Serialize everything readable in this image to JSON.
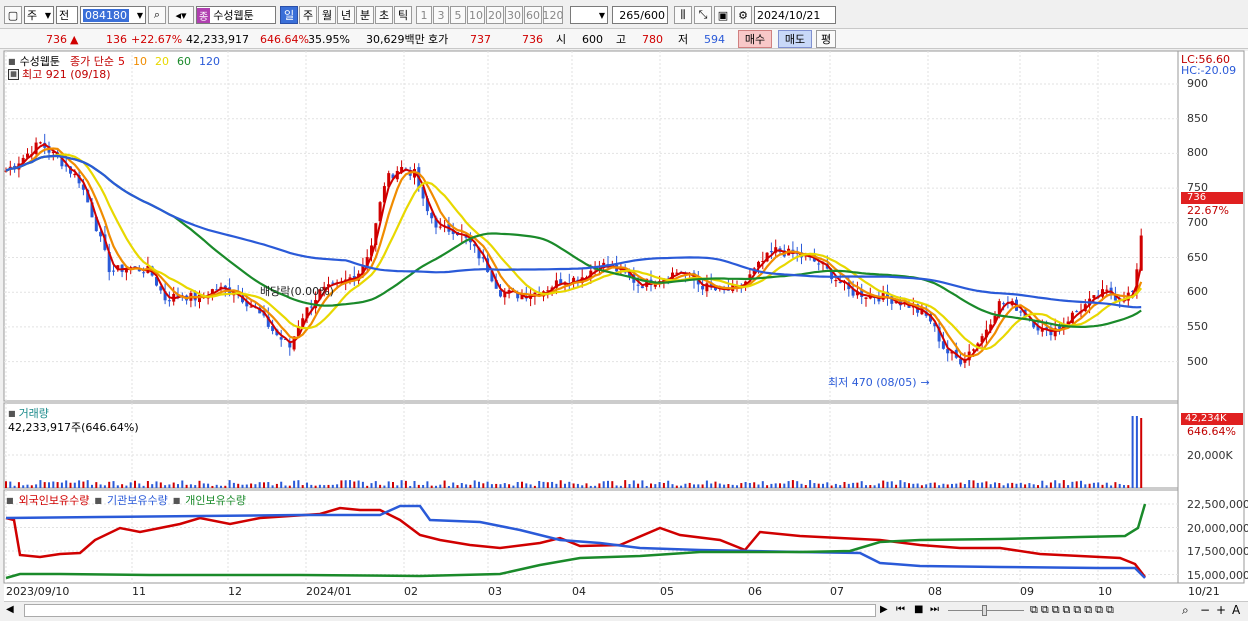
{
  "toolbar": {
    "market": "주",
    "prev_label": "전",
    "code": "084180",
    "stock_name": "수성웹툰",
    "periods": [
      "일",
      "주",
      "월",
      "년",
      "분",
      "초",
      "틱"
    ],
    "selected_period": "일",
    "minute_options": [
      "1",
      "3",
      "5",
      "10",
      "20",
      "30",
      "60",
      "120"
    ],
    "count": "265",
    "max_count": "/600",
    "date": "2024/10/21"
  },
  "quote": {
    "price": "736",
    "change": "136",
    "change_pct": "+22.67%",
    "volume": "42,233,917",
    "volume_ratio": "646.64%",
    "turnover": "35.95%",
    "amount": "30,629백만",
    "bid_label": "호가",
    "ask": "737",
    "bid": "736",
    "open_label": "시",
    "open": "600",
    "high_label": "고",
    "high": "780",
    "low_label": "저",
    "low": "594",
    "buy_label": "매수",
    "sell_label": "매도",
    "avg_label": "평"
  },
  "price_pane": {
    "name": "수성웹툰",
    "ma_label": "종가 단순",
    "ma_periods": [
      {
        "p": "5",
        "color": "#d00000"
      },
      {
        "p": "10",
        "color": "#f08c00"
      },
      {
        "p": "20",
        "color": "#e8d800"
      },
      {
        "p": "60",
        "color": "#1a8a2a"
      },
      {
        "p": "120",
        "color": "#2a5ad8"
      }
    ],
    "max_label": "최고 921 (09/18)",
    "min_label": "최저 470 (08/05)",
    "dividend_label": "배당락(0.00%)",
    "lc": "LC:56.60",
    "hc": "HC:-20.09",
    "current_price": "736",
    "current_pct": "22.67%",
    "y_ticks": [
      "900",
      "850",
      "800",
      "750",
      "700",
      "650",
      "600",
      "550",
      "500"
    ]
  },
  "volume_pane": {
    "title": "거래량",
    "info": "42,233,917주(646.64%)",
    "current": "42,234K",
    "current_pct": "646.64%",
    "y_ticks": [
      "20,000K"
    ]
  },
  "holding_pane": {
    "legend": [
      {
        "label": "외국인보유수량",
        "color": "#d00000"
      },
      {
        "label": "기관보유수량",
        "color": "#2a5ad8"
      },
      {
        "label": "개인보유수량",
        "color": "#1a8a2a"
      }
    ],
    "y_ticks": [
      "22,500,000",
      "20,000,000",
      "17,500,000",
      "15,000,000"
    ]
  },
  "x_axis": [
    "2023/09/10",
    "11",
    "12",
    "2024/01",
    "02",
    "03",
    "04",
    "05",
    "06",
    "07",
    "08",
    "09",
    "10",
    "10/21"
  ],
  "colors": {
    "up": "#d00000",
    "down": "#2a5ad8",
    "price_box": "#e02020"
  }
}
